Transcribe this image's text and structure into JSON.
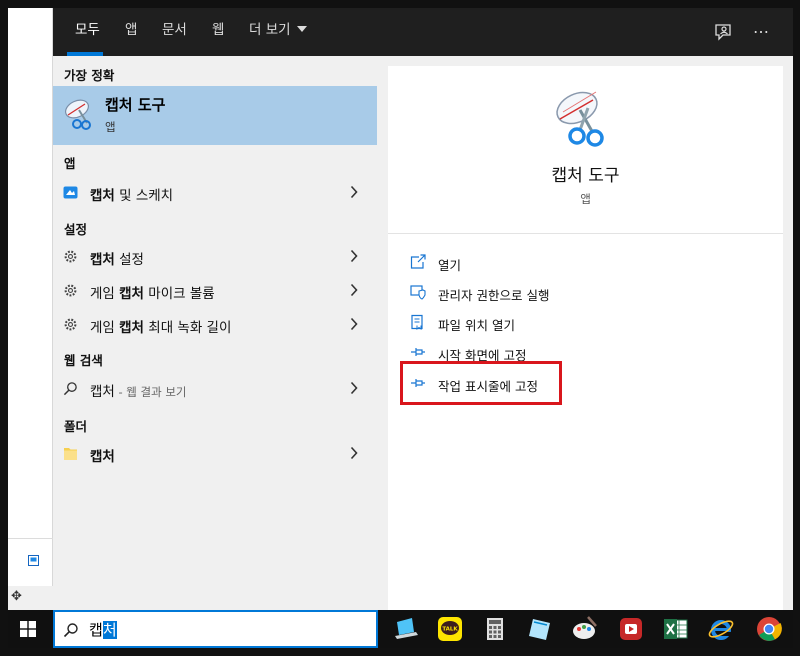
{
  "tabs": [
    {
      "label": "모두",
      "active": true
    },
    {
      "label": "앱"
    },
    {
      "label": "문서"
    },
    {
      "label": "웹"
    },
    {
      "label": "더 보기"
    }
  ],
  "more_menu_icon": "…",
  "sections": {
    "best_match": "가장 정확",
    "apps": "앱",
    "settings": "설정",
    "web": "웹 검색",
    "folders": "폴더"
  },
  "best_match": {
    "title": "캡처 도구",
    "subtitle": "앱"
  },
  "results": {
    "apps": [
      {
        "bold": "캡처",
        "rest": " 및 스케치",
        "icon": "snip-sketch-icon"
      }
    ],
    "settings": [
      {
        "pre": "",
        "bold": "캡처",
        "rest": " 설정",
        "icon": "gear-icon"
      },
      {
        "pre": "게임 ",
        "bold": "캡처",
        "rest": " 마이크 볼륨",
        "icon": "gear-icon"
      },
      {
        "pre": "게임 ",
        "bold": "캡처",
        "rest": " 최대 녹화 길이",
        "icon": "gear-icon"
      }
    ],
    "web": {
      "bold": "캡처",
      "hint": " - 웹 결과 보기",
      "icon": "search-icon"
    },
    "folders": [
      {
        "bold": "캡처",
        "icon": "folder-icon"
      }
    ]
  },
  "detail": {
    "title": "캡처 도구",
    "subtitle": "앱",
    "actions": [
      {
        "label": "열기",
        "icon": "open-icon"
      },
      {
        "label": "관리자 권한으로 실행",
        "icon": "admin-shield-icon"
      },
      {
        "label": "파일 위치 열기",
        "icon": "file-location-icon"
      },
      {
        "label": "시작 화면에 고정",
        "icon": "pin-icon"
      },
      {
        "label": "작업 표시줄에 고정",
        "icon": "pin-icon"
      }
    ]
  },
  "search": {
    "typed": "캡",
    "selected": "처"
  },
  "colors": {
    "accent": "#0078d7",
    "highlight_box": "#d9161c",
    "best_match_bg": "#a8cbe8"
  }
}
